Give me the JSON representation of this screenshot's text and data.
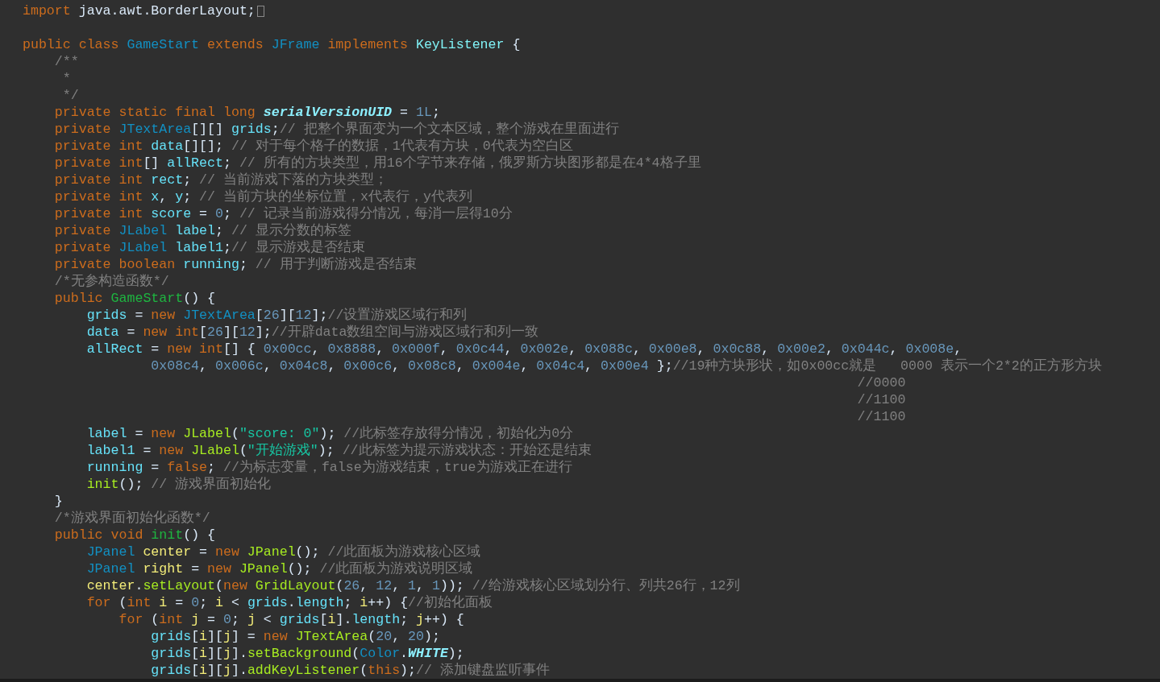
{
  "editor": {
    "lines": [
      {
        "kind": "code",
        "folded": true,
        "tokens": [
          {
            "kind": "keyword",
            "text": "import "
          },
          {
            "kind": "plain",
            "text": "java.awt.BorderLayout;"
          }
        ]
      },
      {
        "kind": "blank"
      },
      {
        "kind": "code",
        "tokens": [
          {
            "kind": "keyword",
            "text": "public class "
          },
          {
            "kind": "type",
            "text": "GameStart"
          },
          {
            "kind": "keyword",
            "text": " extends "
          },
          {
            "kind": "type",
            "text": "JFrame"
          },
          {
            "kind": "keyword",
            "text": " implements "
          },
          {
            "kind": "interface",
            "text": "KeyListener"
          },
          {
            "kind": "plain",
            "text": " {"
          }
        ]
      },
      {
        "kind": "code",
        "tokens": [
          {
            "kind": "comment",
            "text": "    /**"
          }
        ]
      },
      {
        "kind": "code",
        "tokens": [
          {
            "kind": "comment",
            "text": "     *"
          }
        ]
      },
      {
        "kind": "code",
        "tokens": [
          {
            "kind": "comment",
            "text": "     */"
          }
        ]
      },
      {
        "kind": "code",
        "tokens": [
          {
            "kind": "keyword",
            "text": "    private static final long "
          },
          {
            "kind": "constant",
            "text": "serialVersionUID"
          },
          {
            "kind": "plain",
            "text": " = "
          },
          {
            "kind": "number",
            "text": "1L"
          },
          {
            "kind": "plain",
            "text": ";"
          }
        ]
      },
      {
        "kind": "code",
        "tokens": [
          {
            "kind": "keyword",
            "text": "    private "
          },
          {
            "kind": "type",
            "text": "JTextArea"
          },
          {
            "kind": "plain",
            "text": "[][] "
          },
          {
            "kind": "field",
            "text": "grids"
          },
          {
            "kind": "plain",
            "text": ";"
          },
          {
            "kind": "comment",
            "text": "// 把整个界面变为一个文本区域，整个游戏在里面进行"
          }
        ]
      },
      {
        "kind": "code",
        "tokens": [
          {
            "kind": "keyword",
            "text": "    private int "
          },
          {
            "kind": "field",
            "text": "data"
          },
          {
            "kind": "plain",
            "text": "[][]; "
          },
          {
            "kind": "comment",
            "text": "// 对于每个格子的数据，1代表有方块，0代表为空白区"
          }
        ]
      },
      {
        "kind": "code",
        "tokens": [
          {
            "kind": "keyword",
            "text": "    private int"
          },
          {
            "kind": "plain",
            "text": "[] "
          },
          {
            "kind": "field",
            "text": "allRect"
          },
          {
            "kind": "plain",
            "text": "; "
          },
          {
            "kind": "comment",
            "text": "// 所有的方块类型，用16个字节来存储，俄罗斯方块图形都是在4*4格子里"
          }
        ]
      },
      {
        "kind": "code",
        "tokens": [
          {
            "kind": "keyword",
            "text": "    private int "
          },
          {
            "kind": "field",
            "text": "rect"
          },
          {
            "kind": "plain",
            "text": "; "
          },
          {
            "kind": "comment",
            "text": "// 当前游戏下落的方块类型；"
          }
        ]
      },
      {
        "kind": "code",
        "tokens": [
          {
            "kind": "keyword",
            "text": "    private int "
          },
          {
            "kind": "field",
            "text": "x"
          },
          {
            "kind": "plain",
            "text": ", "
          },
          {
            "kind": "field",
            "text": "y"
          },
          {
            "kind": "plain",
            "text": "; "
          },
          {
            "kind": "comment",
            "text": "// 当前方块的坐标位置，x代表行，y代表列"
          }
        ]
      },
      {
        "kind": "code",
        "tokens": [
          {
            "kind": "keyword",
            "text": "    private int "
          },
          {
            "kind": "field",
            "text": "score"
          },
          {
            "kind": "plain",
            "text": " = "
          },
          {
            "kind": "number",
            "text": "0"
          },
          {
            "kind": "plain",
            "text": "; "
          },
          {
            "kind": "comment",
            "text": "// 记录当前游戏得分情况，每消一层得10分"
          }
        ]
      },
      {
        "kind": "code",
        "tokens": [
          {
            "kind": "keyword",
            "text": "    private "
          },
          {
            "kind": "type",
            "text": "JLabel "
          },
          {
            "kind": "field",
            "text": "label"
          },
          {
            "kind": "plain",
            "text": "; "
          },
          {
            "kind": "comment",
            "text": "// 显示分数的标签"
          }
        ]
      },
      {
        "kind": "code",
        "tokens": [
          {
            "kind": "keyword",
            "text": "    private "
          },
          {
            "kind": "type",
            "text": "JLabel "
          },
          {
            "kind": "field",
            "text": "label1"
          },
          {
            "kind": "plain",
            "text": ";"
          },
          {
            "kind": "comment",
            "text": "// 显示游戏是否结束"
          }
        ]
      },
      {
        "kind": "code",
        "tokens": [
          {
            "kind": "keyword",
            "text": "    private boolean "
          },
          {
            "kind": "field",
            "text": "running"
          },
          {
            "kind": "plain",
            "text": "; "
          },
          {
            "kind": "comment",
            "text": "// 用于判断游戏是否结束"
          }
        ]
      },
      {
        "kind": "code",
        "tokens": [
          {
            "kind": "comment",
            "text": "    /*无参构造函数*/"
          }
        ]
      },
      {
        "kind": "code",
        "tokens": [
          {
            "kind": "keyword",
            "text": "    public "
          },
          {
            "kind": "declaration",
            "text": "GameStart"
          },
          {
            "kind": "plain",
            "text": "() {"
          }
        ]
      },
      {
        "kind": "code",
        "tokens": [
          {
            "kind": "field",
            "text": "        grids"
          },
          {
            "kind": "plain",
            "text": " = "
          },
          {
            "kind": "keyword",
            "text": "new "
          },
          {
            "kind": "type",
            "text": "JTextArea"
          },
          {
            "kind": "plain",
            "text": "["
          },
          {
            "kind": "number",
            "text": "26"
          },
          {
            "kind": "plain",
            "text": "]["
          },
          {
            "kind": "number",
            "text": "12"
          },
          {
            "kind": "plain",
            "text": "];"
          },
          {
            "kind": "comment",
            "text": "//设置游戏区域行和列"
          }
        ]
      },
      {
        "kind": "code",
        "tokens": [
          {
            "kind": "field",
            "text": "        data"
          },
          {
            "kind": "plain",
            "text": " = "
          },
          {
            "kind": "keyword",
            "text": "new int"
          },
          {
            "kind": "plain",
            "text": "["
          },
          {
            "kind": "number",
            "text": "26"
          },
          {
            "kind": "plain",
            "text": "]["
          },
          {
            "kind": "number",
            "text": "12"
          },
          {
            "kind": "plain",
            "text": "];"
          },
          {
            "kind": "comment",
            "text": "//开辟data数组空间与游戏区域行和列一致"
          }
        ]
      },
      {
        "kind": "code",
        "tokens": [
          {
            "kind": "field",
            "text": "        allRect"
          },
          {
            "kind": "plain",
            "text": " = "
          },
          {
            "kind": "keyword",
            "text": "new int"
          },
          {
            "kind": "plain",
            "text": "[] { "
          },
          {
            "kind": "number",
            "text": "0x00cc"
          },
          {
            "kind": "plain",
            "text": ", "
          },
          {
            "kind": "number",
            "text": "0x8888"
          },
          {
            "kind": "plain",
            "text": ", "
          },
          {
            "kind": "number",
            "text": "0x000f"
          },
          {
            "kind": "plain",
            "text": ", "
          },
          {
            "kind": "number",
            "text": "0x0c44"
          },
          {
            "kind": "plain",
            "text": ", "
          },
          {
            "kind": "number",
            "text": "0x002e"
          },
          {
            "kind": "plain",
            "text": ", "
          },
          {
            "kind": "number",
            "text": "0x088c"
          },
          {
            "kind": "plain",
            "text": ", "
          },
          {
            "kind": "number",
            "text": "0x00e8"
          },
          {
            "kind": "plain",
            "text": ", "
          },
          {
            "kind": "number",
            "text": "0x0c88"
          },
          {
            "kind": "plain",
            "text": ", "
          },
          {
            "kind": "number",
            "text": "0x00e2"
          },
          {
            "kind": "plain",
            "text": ", "
          },
          {
            "kind": "number",
            "text": "0x044c"
          },
          {
            "kind": "plain",
            "text": ", "
          },
          {
            "kind": "number",
            "text": "0x008e"
          },
          {
            "kind": "plain",
            "text": ","
          }
        ]
      },
      {
        "kind": "code",
        "tokens": [
          {
            "kind": "number",
            "text": "                0x08c4"
          },
          {
            "kind": "plain",
            "text": ", "
          },
          {
            "kind": "number",
            "text": "0x006c"
          },
          {
            "kind": "plain",
            "text": ", "
          },
          {
            "kind": "number",
            "text": "0x04c8"
          },
          {
            "kind": "plain",
            "text": ", "
          },
          {
            "kind": "number",
            "text": "0x00c6"
          },
          {
            "kind": "plain",
            "text": ", "
          },
          {
            "kind": "number",
            "text": "0x08c8"
          },
          {
            "kind": "plain",
            "text": ", "
          },
          {
            "kind": "number",
            "text": "0x004e"
          },
          {
            "kind": "plain",
            "text": ", "
          },
          {
            "kind": "number",
            "text": "0x04c4"
          },
          {
            "kind": "plain",
            "text": ", "
          },
          {
            "kind": "number",
            "text": "0x00e4"
          },
          {
            "kind": "plain",
            "text": " };"
          },
          {
            "kind": "comment",
            "text": "//19种方块形状，如0x00cc就是   0000 表示一个2*2的正方形方块"
          }
        ]
      },
      {
        "kind": "code",
        "tokens": [
          {
            "kind": "comment",
            "text": "                                                                                                        //0000"
          }
        ]
      },
      {
        "kind": "code",
        "tokens": [
          {
            "kind": "comment",
            "text": "                                                                                                        //1100"
          }
        ]
      },
      {
        "kind": "code",
        "tokens": [
          {
            "kind": "comment",
            "text": "                                                                                                        //1100"
          }
        ]
      },
      {
        "kind": "code",
        "tokens": [
          {
            "kind": "field",
            "text": "        label"
          },
          {
            "kind": "plain",
            "text": " = "
          },
          {
            "kind": "keyword",
            "text": "new "
          },
          {
            "kind": "method",
            "text": "JLabel"
          },
          {
            "kind": "plain",
            "text": "("
          },
          {
            "kind": "string",
            "text": "\"score: 0\""
          },
          {
            "kind": "plain",
            "text": "); "
          },
          {
            "kind": "comment",
            "text": "//此标签存放得分情况，初始化为0分"
          }
        ]
      },
      {
        "kind": "code",
        "tokens": [
          {
            "kind": "field",
            "text": "        label1"
          },
          {
            "kind": "plain",
            "text": " = "
          },
          {
            "kind": "keyword",
            "text": "new "
          },
          {
            "kind": "method",
            "text": "JLabel"
          },
          {
            "kind": "plain",
            "text": "("
          },
          {
            "kind": "string",
            "text": "\"开始游戏\""
          },
          {
            "kind": "plain",
            "text": "); "
          },
          {
            "kind": "comment",
            "text": "//此标签为提示游戏状态：开始还是结束"
          }
        ]
      },
      {
        "kind": "code",
        "tokens": [
          {
            "kind": "field",
            "text": "        running"
          },
          {
            "kind": "plain",
            "text": " = "
          },
          {
            "kind": "keyword",
            "text": "false"
          },
          {
            "kind": "plain",
            "text": "; "
          },
          {
            "kind": "comment",
            "text": "//为标志变量，false为游戏结束，true为游戏正在进行"
          }
        ]
      },
      {
        "kind": "code",
        "tokens": [
          {
            "kind": "method",
            "text": "        init"
          },
          {
            "kind": "plain",
            "text": "(); "
          },
          {
            "kind": "comment",
            "text": "// 游戏界面初始化"
          }
        ]
      },
      {
        "kind": "code",
        "tokens": [
          {
            "kind": "plain",
            "text": "    }"
          }
        ]
      },
      {
        "kind": "code",
        "tokens": [
          {
            "kind": "comment",
            "text": "    /*游戏界面初始化函数*/"
          }
        ]
      },
      {
        "kind": "code",
        "tokens": [
          {
            "kind": "keyword",
            "text": "    public void "
          },
          {
            "kind": "declaration",
            "text": "init"
          },
          {
            "kind": "plain",
            "text": "() {"
          }
        ]
      },
      {
        "kind": "code",
        "tokens": [
          {
            "kind": "type",
            "text": "        JPanel "
          },
          {
            "kind": "local",
            "text": "center"
          },
          {
            "kind": "plain",
            "text": " = "
          },
          {
            "kind": "keyword",
            "text": "new "
          },
          {
            "kind": "method",
            "text": "JPanel"
          },
          {
            "kind": "plain",
            "text": "(); "
          },
          {
            "kind": "comment",
            "text": "//此面板为游戏核心区域"
          }
        ]
      },
      {
        "kind": "code",
        "tokens": [
          {
            "kind": "type",
            "text": "        JPanel "
          },
          {
            "kind": "local",
            "text": "right"
          },
          {
            "kind": "plain",
            "text": " = "
          },
          {
            "kind": "keyword",
            "text": "new "
          },
          {
            "kind": "method",
            "text": "JPanel"
          },
          {
            "kind": "plain",
            "text": "(); "
          },
          {
            "kind": "comment",
            "text": "//此面板为游戏说明区域"
          }
        ]
      },
      {
        "kind": "code",
        "tokens": [
          {
            "kind": "local",
            "text": "        center"
          },
          {
            "kind": "plain",
            "text": "."
          },
          {
            "kind": "method",
            "text": "setLayout"
          },
          {
            "kind": "plain",
            "text": "("
          },
          {
            "kind": "keyword",
            "text": "new "
          },
          {
            "kind": "method",
            "text": "GridLayout"
          },
          {
            "kind": "plain",
            "text": "("
          },
          {
            "kind": "number",
            "text": "26"
          },
          {
            "kind": "plain",
            "text": ", "
          },
          {
            "kind": "number",
            "text": "12"
          },
          {
            "kind": "plain",
            "text": ", "
          },
          {
            "kind": "number",
            "text": "1"
          },
          {
            "kind": "plain",
            "text": ", "
          },
          {
            "kind": "number",
            "text": "1"
          },
          {
            "kind": "plain",
            "text": ")); "
          },
          {
            "kind": "comment",
            "text": "//给游戏核心区域划分行、列共26行，12列"
          }
        ]
      },
      {
        "kind": "code",
        "tokens": [
          {
            "kind": "keyword",
            "text": "        for"
          },
          {
            "kind": "plain",
            "text": " ("
          },
          {
            "kind": "keyword",
            "text": "int "
          },
          {
            "kind": "local",
            "text": "i"
          },
          {
            "kind": "plain",
            "text": " = "
          },
          {
            "kind": "number",
            "text": "0"
          },
          {
            "kind": "plain",
            "text": "; "
          },
          {
            "kind": "local",
            "text": "i"
          },
          {
            "kind": "plain",
            "text": " < "
          },
          {
            "kind": "field",
            "text": "grids"
          },
          {
            "kind": "plain",
            "text": "."
          },
          {
            "kind": "field",
            "text": "length"
          },
          {
            "kind": "plain",
            "text": "; "
          },
          {
            "kind": "local",
            "text": "i"
          },
          {
            "kind": "plain",
            "text": "++) {"
          },
          {
            "kind": "comment",
            "text": "//初始化面板"
          }
        ]
      },
      {
        "kind": "code",
        "tokens": [
          {
            "kind": "keyword",
            "text": "            for"
          },
          {
            "kind": "plain",
            "text": " ("
          },
          {
            "kind": "keyword",
            "text": "int "
          },
          {
            "kind": "local",
            "text": "j"
          },
          {
            "kind": "plain",
            "text": " = "
          },
          {
            "kind": "number",
            "text": "0"
          },
          {
            "kind": "plain",
            "text": "; "
          },
          {
            "kind": "local",
            "text": "j"
          },
          {
            "kind": "plain",
            "text": " < "
          },
          {
            "kind": "field",
            "text": "grids"
          },
          {
            "kind": "plain",
            "text": "["
          },
          {
            "kind": "local",
            "text": "i"
          },
          {
            "kind": "plain",
            "text": "]."
          },
          {
            "kind": "field",
            "text": "length"
          },
          {
            "kind": "plain",
            "text": "; "
          },
          {
            "kind": "local",
            "text": "j"
          },
          {
            "kind": "plain",
            "text": "++) {"
          }
        ]
      },
      {
        "kind": "code",
        "tokens": [
          {
            "kind": "field",
            "text": "                grids"
          },
          {
            "kind": "plain",
            "text": "["
          },
          {
            "kind": "local",
            "text": "i"
          },
          {
            "kind": "plain",
            "text": "]["
          },
          {
            "kind": "local",
            "text": "j"
          },
          {
            "kind": "plain",
            "text": "] = "
          },
          {
            "kind": "keyword",
            "text": "new "
          },
          {
            "kind": "method",
            "text": "JTextArea"
          },
          {
            "kind": "plain",
            "text": "("
          },
          {
            "kind": "number",
            "text": "20"
          },
          {
            "kind": "plain",
            "text": ", "
          },
          {
            "kind": "number",
            "text": "20"
          },
          {
            "kind": "plain",
            "text": ");"
          }
        ]
      },
      {
        "kind": "code",
        "tokens": [
          {
            "kind": "field",
            "text": "                grids"
          },
          {
            "kind": "plain",
            "text": "["
          },
          {
            "kind": "local",
            "text": "i"
          },
          {
            "kind": "plain",
            "text": "]["
          },
          {
            "kind": "local",
            "text": "j"
          },
          {
            "kind": "plain",
            "text": "]."
          },
          {
            "kind": "method",
            "text": "setBackground"
          },
          {
            "kind": "plain",
            "text": "("
          },
          {
            "kind": "type",
            "text": "Color"
          },
          {
            "kind": "plain",
            "text": "."
          },
          {
            "kind": "constant",
            "text": "WHITE"
          },
          {
            "kind": "plain",
            "text": ");"
          }
        ]
      },
      {
        "kind": "code",
        "tokens": [
          {
            "kind": "field",
            "text": "                grids"
          },
          {
            "kind": "plain",
            "text": "["
          },
          {
            "kind": "local",
            "text": "i"
          },
          {
            "kind": "plain",
            "text": "]["
          },
          {
            "kind": "local",
            "text": "j"
          },
          {
            "kind": "plain",
            "text": "]."
          },
          {
            "kind": "method",
            "text": "addKeyListener"
          },
          {
            "kind": "plain",
            "text": "("
          },
          {
            "kind": "keyword",
            "text": "this"
          },
          {
            "kind": "plain",
            "text": ");"
          },
          {
            "kind": "comment",
            "text": "// 添加键盘监听事件"
          }
        ]
      }
    ]
  }
}
